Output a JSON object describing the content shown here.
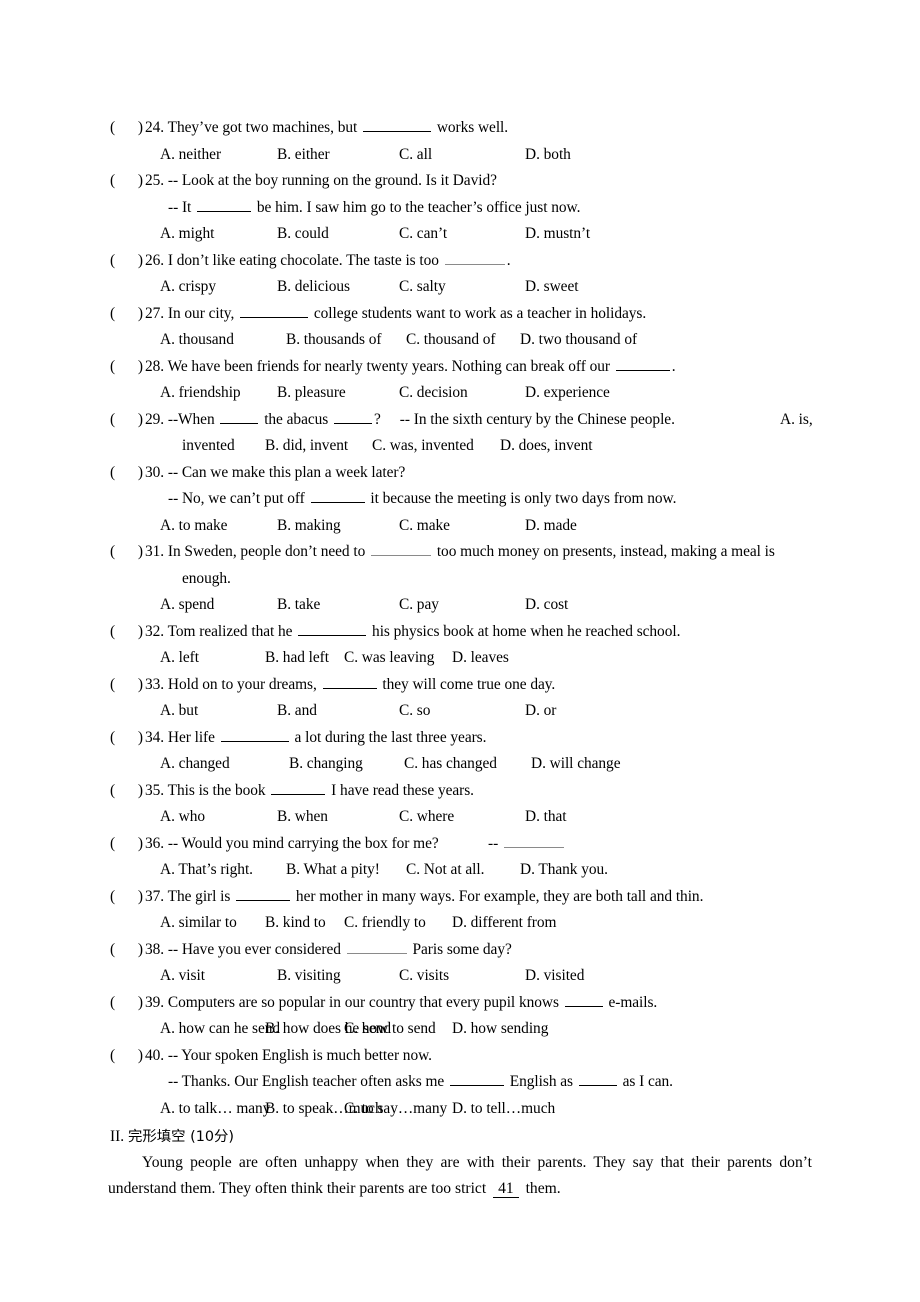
{
  "document": {
    "type": "english-exam-paper",
    "language": "en-zh"
  },
  "questions": [
    {
      "number": "24",
      "marker": "(      )",
      "stem_parts": [
        "24. They’ve got two machines, but ",
        "BLANK_LG",
        " works well."
      ],
      "options": [
        "A. neither",
        "B. either",
        "C. all",
        "D. both"
      ],
      "option_grid": "wide"
    },
    {
      "number": "25",
      "marker": "(      )",
      "stem_parts": [
        "25. -- Look at the boy running on the ground. Is it David?"
      ],
      "stem_line2": [
        "-- It ",
        "BLANK_MD",
        " be him. I saw him go to the teacher’s office just now."
      ],
      "options": [
        "A. might",
        "B. could",
        "C. can’t",
        "D. mustn’t"
      ],
      "option_grid": "wide"
    },
    {
      "number": "26",
      "marker": "(      )",
      "stem_parts": [
        "26. I don’t like eating chocolate. The taste is too ",
        "BLANK_FAINT",
        "."
      ],
      "options": [
        "A. crispy",
        "B. delicious",
        "C. salty",
        "D. sweet"
      ],
      "option_grid": "wide"
    },
    {
      "number": "27",
      "marker": "(      )",
      "stem_parts": [
        "27. In our city, ",
        "BLANK_LG",
        " college students want to work as a teacher in holidays."
      ],
      "options": [
        "A. thousand",
        "B. thousands of",
        "C. thousand of",
        "D. two thousand of"
      ],
      "option_grid": "tight"
    },
    {
      "number": "28",
      "marker": "(      )",
      "stem_parts": [
        "28. We have been friends for nearly twenty years. Nothing can break off our ",
        "BLANK_MD",
        "."
      ],
      "options": [
        "A. friendship",
        "B. pleasure",
        "C. decision",
        "D. experience"
      ],
      "option_grid": "wide"
    },
    {
      "number": "29",
      "marker": "(      )",
      "stem_parts": [
        "29. --When ",
        "BLANK_SM",
        " the abacus ",
        "BLANK_SM",
        "?",
        "SPACE",
        "-- In the sixth century by the Chinese people."
      ],
      "right_fragment": "A. is,",
      "continuation": [
        "invented",
        "B. did, invent",
        "C. was, invented",
        "D. does, invent"
      ],
      "option_grid": "continuation"
    },
    {
      "number": "30",
      "marker": "(      )",
      "stem_parts": [
        "30. -- Can we make this plan a week later?"
      ],
      "stem_line2": [
        "-- No, we can’t put off ",
        "BLANK_MD",
        " it because the meeting is only two days from now."
      ],
      "options": [
        "A. to make",
        "B. making",
        "C. make",
        "D. made"
      ],
      "option_grid": "wide"
    },
    {
      "number": "31",
      "marker": "(      )",
      "stem_parts": [
        "31. In Sweden, people don’t need to ",
        "BLANK_FAINT",
        " too much money on presents, instead, making a meal is"
      ],
      "stem_cont": "enough.",
      "options": [
        "A. spend",
        "B. take",
        "C. pay",
        "D. cost"
      ],
      "option_grid": "wide"
    },
    {
      "number": "32",
      "marker": "(      )",
      "stem_parts": [
        "32. Tom realized that he ",
        "BLANK_LG",
        " his physics book at home when he reached school."
      ],
      "options": [
        "A. left",
        "B. had left",
        "C. was leaving",
        "D. leaves"
      ],
      "option_grid": "narrow"
    },
    {
      "number": "33",
      "marker": "(      )",
      "stem_parts": [
        "33. Hold on to your dreams, ",
        "BLANK_MD",
        " they will come true one day."
      ],
      "options": [
        "A. but",
        "B. and",
        "C. so",
        "D. or"
      ],
      "option_grid": "wide"
    },
    {
      "number": "34",
      "marker": "(      )",
      "stem_parts": [
        "34. Her life ",
        "BLANK_LG",
        " a lot during the last three years."
      ],
      "options": [
        "A. changed",
        "B. changing",
        "C. has changed",
        "D. will change"
      ],
      "option_grid": "wider"
    },
    {
      "number": "35",
      "marker": "(      )",
      "stem_parts": [
        "35. This is the book ",
        "BLANK_MD",
        " I have read these years."
      ],
      "options": [
        "A. who",
        "B. when",
        "C. where",
        "D. that"
      ],
      "option_grid": "wide"
    },
    {
      "number": "36",
      "marker": "(      )",
      "stem_parts": [
        "36. -- Would you mind carrying the box for me?",
        "SPACEWIDE",
        "-- ",
        "BLANK_FAINT"
      ],
      "options": [
        "A. That’s right.",
        "B. What a pity!",
        "C. Not at all.",
        "D. Thank you."
      ],
      "option_grid": "tight"
    },
    {
      "number": "37",
      "marker": "(      )",
      "stem_parts": [
        "37. The girl is ",
        "BLANK_MD",
        " her mother in many ways. For example, they are both tall and thin."
      ],
      "options": [
        "A. similar to",
        "B. kind to",
        "C. friendly to",
        "D. different from"
      ],
      "option_grid": "narrow"
    },
    {
      "number": "38",
      "marker": "(      )",
      "stem_parts": [
        "38. -- Have you ever considered ",
        "BLANK_FAINT",
        " Paris some day?"
      ],
      "options": [
        "A. visit",
        "B. visiting",
        "C. visits",
        "D. visited"
      ],
      "option_grid": "wide"
    },
    {
      "number": "39",
      "marker": "(      )",
      "stem_parts": [
        "39. Computers are so popular in our country that every pupil knows ",
        "BLANK_SM",
        " e-mails."
      ],
      "options": [
        "A. how can he send",
        "B. how does he send",
        "C. how to send",
        "D. how sending"
      ],
      "option_grid": "narrow"
    },
    {
      "number": "40",
      "marker": "(      )",
      "stem_parts": [
        "40. -- Your spoken English is much better now."
      ],
      "stem_line2": [
        "-- Thanks. Our English teacher often asks me ",
        "BLANK_MD",
        " English as ",
        "BLANK_SM",
        " as I can."
      ],
      "options": [
        "A. to talk… many",
        "B. to speak…much",
        "C. to say…many",
        "D. to tell…much"
      ],
      "option_grid": "narrow"
    }
  ],
  "section_two": {
    "heading_roman": "II.",
    "heading_cn": "完形填空",
    "heading_score": "(10分)",
    "paragraph_part1": "Young people are often unhappy when they are with their parents. They say that their parents don’t understand them. They often think their parents are too strict ",
    "paragraph_blank": "41",
    "paragraph_part2": " them."
  }
}
